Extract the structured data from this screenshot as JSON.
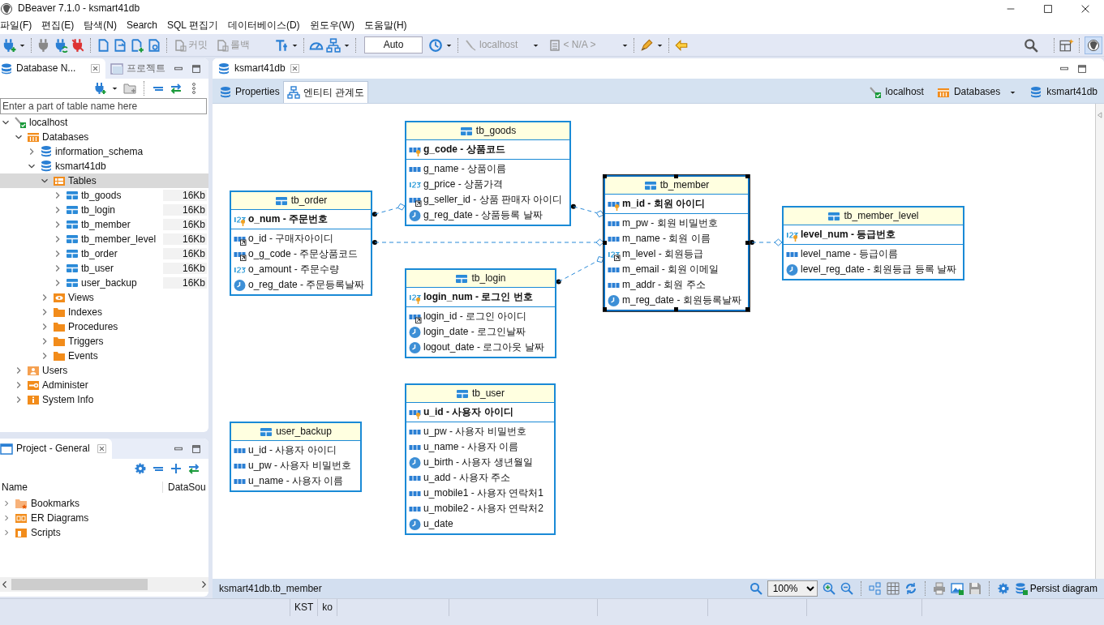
{
  "window": {
    "title": "DBeaver 7.1.0 - ksmart41db"
  },
  "menu": [
    "파일(F)",
    "편집(E)",
    "탐색(N)",
    "Search",
    "SQL 편집기",
    "데이터베이스(D)",
    "윈도우(W)",
    "도움말(H)"
  ],
  "toolbar": {
    "commit": {
      "label": "커밋",
      "disabled": true
    },
    "rollback": {
      "label": "롤백",
      "disabled": true
    },
    "transaction_mode": {
      "value": "Auto"
    },
    "connection": {
      "label": "localhost",
      "disabled": true
    },
    "schema": {
      "label": "< N/A >",
      "disabled": true
    }
  },
  "navigator": {
    "tabs": [
      {
        "label": "Database N...",
        "selected": true
      },
      {
        "label": "프로젝트",
        "selected": false
      }
    ],
    "filter": {
      "placeholder": "Enter a part of table name here"
    },
    "tree": [
      {
        "label": "localhost",
        "kind": "server",
        "expanded": true,
        "selected": false,
        "children": [
          {
            "label": "Databases",
            "kind": "databases",
            "expanded": true,
            "selected": false,
            "children": [
              {
                "label": "information_schema",
                "kind": "database",
                "expanded": false,
                "selected": false
              },
              {
                "label": "ksmart41db",
                "kind": "database",
                "expanded": true,
                "selected": false,
                "children": [
                  {
                    "label": "Tables",
                    "kind": "tables",
                    "expanded": true,
                    "selected": true,
                    "children": [
                      {
                        "label": "tb_goods",
                        "kind": "table",
                        "size": "16Kb",
                        "expanded": false,
                        "selected": false
                      },
                      {
                        "label": "tb_login",
                        "kind": "table",
                        "size": "16Kb",
                        "expanded": false,
                        "selected": false
                      },
                      {
                        "label": "tb_member",
                        "kind": "table",
                        "size": "16Kb",
                        "expanded": false,
                        "selected": false
                      },
                      {
                        "label": "tb_member_level",
                        "kind": "table",
                        "size": "16Kb",
                        "expanded": false,
                        "selected": false
                      },
                      {
                        "label": "tb_order",
                        "kind": "table",
                        "size": "16Kb",
                        "expanded": false,
                        "selected": false
                      },
                      {
                        "label": "tb_user",
                        "kind": "table",
                        "size": "16Kb",
                        "expanded": false,
                        "selected": false
                      },
                      {
                        "label": "user_backup",
                        "kind": "table",
                        "size": "16Kb",
                        "expanded": false,
                        "selected": false
                      }
                    ]
                  },
                  {
                    "label": "Views",
                    "kind": "views",
                    "expanded": false,
                    "selected": false
                  },
                  {
                    "label": "Indexes",
                    "kind": "folder",
                    "expanded": false,
                    "selected": false
                  },
                  {
                    "label": "Procedures",
                    "kind": "folder",
                    "expanded": false,
                    "selected": false
                  },
                  {
                    "label": "Triggers",
                    "kind": "folder",
                    "expanded": false,
                    "selected": false
                  },
                  {
                    "label": "Events",
                    "kind": "folder",
                    "expanded": false,
                    "selected": false
                  }
                ]
              }
            ]
          },
          {
            "label": "Users",
            "kind": "users",
            "expanded": false,
            "selected": false
          },
          {
            "label": "Administer",
            "kind": "admin",
            "expanded": false,
            "selected": false
          },
          {
            "label": "System Info",
            "kind": "info",
            "expanded": false,
            "selected": false
          }
        ]
      }
    ]
  },
  "project": {
    "title": "Project - General",
    "columns": [
      "Name",
      "DataSou"
    ],
    "items": [
      {
        "label": "Bookmarks",
        "kind": "bookmarks"
      },
      {
        "label": "ER Diagrams",
        "kind": "diagrams"
      },
      {
        "label": "Scripts",
        "kind": "scripts"
      }
    ]
  },
  "editor": {
    "tab": {
      "label": "ksmart41db"
    },
    "subtabs": [
      {
        "label": "Properties",
        "selected": false
      },
      {
        "label": "엔티티 관계도",
        "selected": true
      }
    ],
    "breadcrumb": [
      {
        "label": "localhost",
        "kind": "server"
      },
      {
        "label": "Databases",
        "kind": "databases"
      },
      {
        "label": "ksmart41db",
        "kind": "database"
      }
    ],
    "diagram": {
      "tables": [
        {
          "name": "tb_goods",
          "selected": false,
          "key_columns": [
            {
              "label": "g_code - 상품코드",
              "kind": "text_pk"
            }
          ],
          "columns": [
            {
              "label": "g_name - 상품이름",
              "kind": "text"
            },
            {
              "label": "g_price - 상품가격",
              "kind": "number"
            },
            {
              "label": "g_seller_id - 상품 판매자 아이디",
              "kind": "text_fk"
            },
            {
              "label": "g_reg_date - 상품등록 날짜",
              "kind": "date"
            }
          ]
        },
        {
          "name": "tb_order",
          "selected": false,
          "key_columns": [
            {
              "label": "o_num - 주문번호",
              "kind": "number_pk"
            }
          ],
          "columns": [
            {
              "label": "o_id - 구매자아이디",
              "kind": "text_fk"
            },
            {
              "label": "o_g_code - 주문상품코드",
              "kind": "text_fk"
            },
            {
              "label": "o_amount - 주문수량",
              "kind": "number"
            },
            {
              "label": "o_reg_date - 주문등록날짜",
              "kind": "date"
            }
          ]
        },
        {
          "name": "tb_member",
          "selected": true,
          "key_columns": [
            {
              "label": "m_id - 회원 아이디",
              "kind": "text_pk"
            }
          ],
          "columns": [
            {
              "label": "m_pw - 회원 비밀번호",
              "kind": "text"
            },
            {
              "label": "m_name - 회원 이름",
              "kind": "text"
            },
            {
              "label": "m_level - 회원등급",
              "kind": "number_fk"
            },
            {
              "label": "m_email - 회원 이메일",
              "kind": "text"
            },
            {
              "label": "m_addr - 회원 주소",
              "kind": "text"
            },
            {
              "label": "m_reg_date - 회원등록날짜",
              "kind": "date"
            }
          ]
        },
        {
          "name": "tb_member_level",
          "selected": false,
          "key_columns": [
            {
              "label": "level_num - 등급번호",
              "kind": "number_pk"
            }
          ],
          "columns": [
            {
              "label": "level_name - 등급이름",
              "kind": "text"
            },
            {
              "label": "level_reg_date - 회원등급 등록 날짜",
              "kind": "date"
            }
          ]
        },
        {
          "name": "tb_login",
          "selected": false,
          "key_columns": [
            {
              "label": "login_num - 로그인 번호",
              "kind": "number_pk"
            }
          ],
          "columns": [
            {
              "label": "login_id - 로그인 아이디",
              "kind": "text_fk"
            },
            {
              "label": "login_date - 로그인날짜",
              "kind": "date"
            },
            {
              "label": "logout_date - 로그아웃 날짜",
              "kind": "date"
            }
          ]
        },
        {
          "name": "user_backup",
          "selected": false,
          "columns": [
            {
              "label": "u_id - 사용자 아이디",
              "kind": "text"
            },
            {
              "label": "u_pw - 사용자 비밀번호",
              "kind": "text"
            },
            {
              "label": "u_name - 사용자 이름",
              "kind": "text"
            }
          ]
        },
        {
          "name": "tb_user",
          "selected": false,
          "key_columns": [
            {
              "label": "u_id - 사용자 아이디",
              "kind": "text_pk"
            }
          ],
          "columns": [
            {
              "label": "u_pw - 사용자 비밀번호",
              "kind": "text"
            },
            {
              "label": "u_name - 사용자 이름",
              "kind": "text"
            },
            {
              "label": "u_birth - 사용자 생년월일",
              "kind": "date"
            },
            {
              "label": "u_add - 사용자 주소",
              "kind": "text"
            },
            {
              "label": "u_mobile1 - 사용자 연락처1",
              "kind": "text"
            },
            {
              "label": "u_mobile2 - 사용자 연락처2",
              "kind": "text"
            },
            {
              "label": "u_date",
              "kind": "date"
            }
          ]
        }
      ]
    },
    "status": {
      "path": "ksmart41db.tb_member",
      "zoom": "100%",
      "persist": "Persist diagram"
    }
  },
  "status_bar": [
    "KST",
    "ko"
  ]
}
